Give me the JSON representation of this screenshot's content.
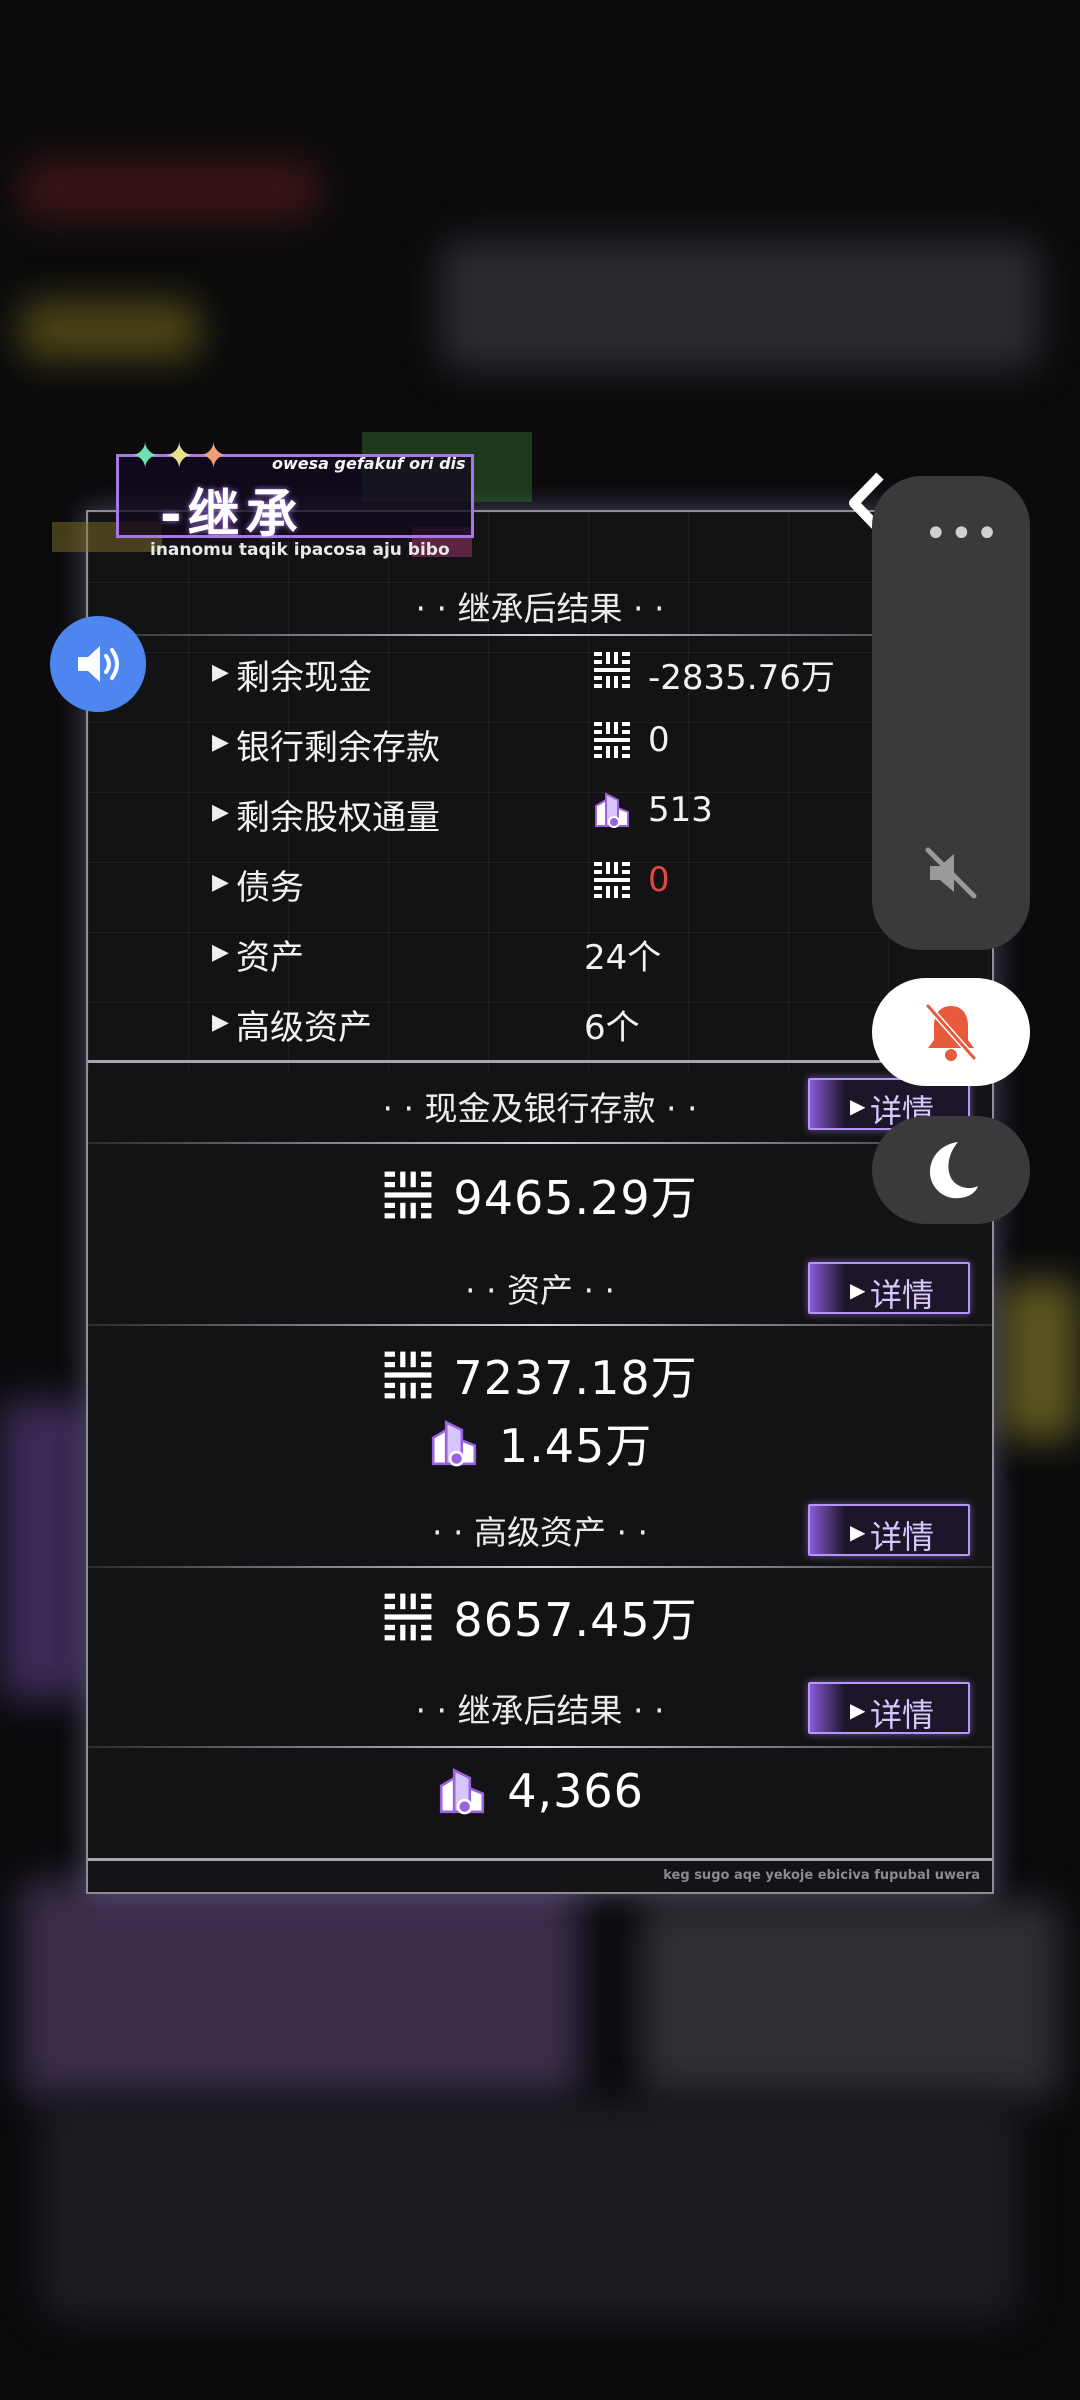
{
  "title": {
    "stars": "✦✦✦",
    "subtitle": "owesa gefakuf ori dis",
    "main": "-继承",
    "footnote": "inanomu taqik ipacosa aju bibo"
  },
  "summary": {
    "heading": "· · 继承后结果 · ·",
    "rows": [
      {
        "label": "剩余现金",
        "icon": "cash-icon",
        "value": "-2835.76万"
      },
      {
        "label": "银行剩余存款",
        "icon": "cash-icon",
        "value": "0"
      },
      {
        "label": "剩余股权通量",
        "icon": "equity-icon",
        "value": "513"
      },
      {
        "label": "债务",
        "icon": "cash-icon",
        "value": "0"
      },
      {
        "label": "资产",
        "icon": "",
        "value": "24个"
      },
      {
        "label": "高级资产",
        "icon": "",
        "value": "6个"
      }
    ]
  },
  "sections": [
    {
      "heading": "· · 现金及银行存款 · ·",
      "detail": "详情",
      "values": [
        {
          "icon": "cash-icon",
          "value": "9465.29万"
        }
      ]
    },
    {
      "heading": "· ·  资产  · ·",
      "detail": "详情",
      "values": [
        {
          "icon": "cash-icon",
          "value": "7237.18万"
        },
        {
          "icon": "equity-icon",
          "value": "1.45万"
        }
      ]
    },
    {
      "heading": "· ·  高级资产  · ·",
      "detail": "详情",
      "values": [
        {
          "icon": "cash-icon",
          "value": "8657.45万"
        }
      ]
    },
    {
      "heading": "· · 继承后结果 · ·",
      "detail": "详情",
      "values": [
        {
          "icon": "equity-icon",
          "value": "4,366"
        }
      ]
    }
  ],
  "footer": "keg sugo aqe yekoje ebiciva fupubal uwera",
  "side_controls": {
    "more": "•••"
  },
  "colors": {
    "accent": "#b894ff",
    "negative": "#e2483d",
    "speaker": "#4e86f0",
    "bell_alert": "#e85a3c"
  }
}
